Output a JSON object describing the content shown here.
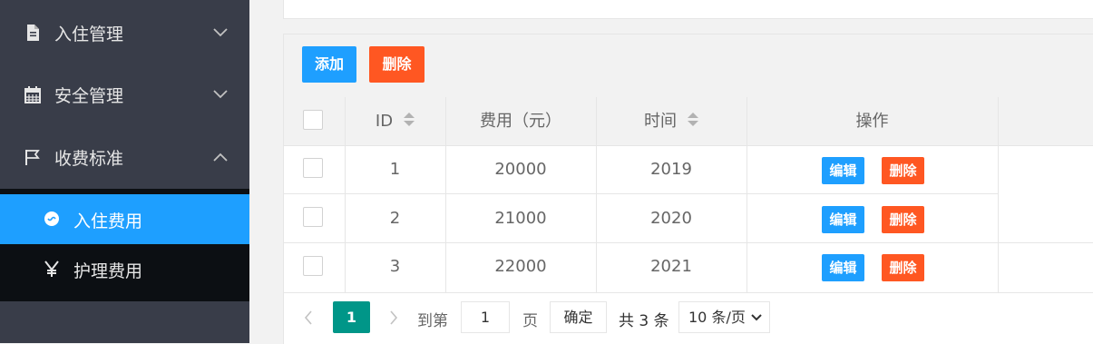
{
  "sidebar": {
    "items": [
      {
        "label": "入住管理",
        "icon": "document-icon",
        "expanded": false
      },
      {
        "label": "安全管理",
        "icon": "calendar-icon",
        "expanded": false
      },
      {
        "label": "收费标准",
        "icon": "flag-icon",
        "expanded": true
      }
    ],
    "subitems": [
      {
        "label": "入住费用",
        "icon": "circle-icon",
        "active": true
      },
      {
        "label": "护理费用",
        "icon": "yen-icon",
        "active": false
      }
    ]
  },
  "toolbar": {
    "add_label": "添加",
    "delete_label": "删除"
  },
  "table": {
    "columns": [
      "ID",
      "费用（元）",
      "时间",
      "操作"
    ],
    "rows": [
      {
        "id": "1",
        "fee": "20000",
        "time": "2019",
        "edit": "编辑",
        "del": "删除"
      },
      {
        "id": "2",
        "fee": "21000",
        "time": "2020",
        "edit": "编辑",
        "del": "删除"
      },
      {
        "id": "3",
        "fee": "22000",
        "time": "2021",
        "edit": "编辑",
        "del": "删除"
      }
    ]
  },
  "pager": {
    "current": "1",
    "goto_label": "到第",
    "page_value": "1",
    "page_unit": "页",
    "confirm_label": "确定",
    "total_label": "共 3 条",
    "size_label": "10 条/页"
  },
  "colors": {
    "sidebar_bg": "#393d49",
    "active": "#1e9fff",
    "danger": "#ff5722",
    "pager_current": "#009688"
  }
}
